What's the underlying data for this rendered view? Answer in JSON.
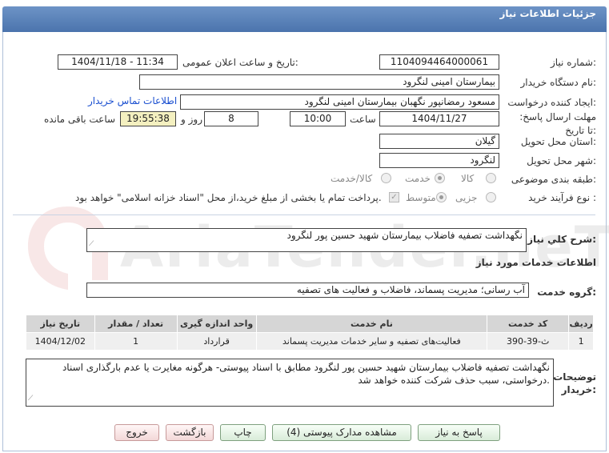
{
  "title": "جزئیات اطلاعات نیاز",
  "labels": {
    "need_number": "شماره نیاز:",
    "announce_datetime": "تاریخ و ساعت اعلان عمومی:",
    "buyer_org": "نام دستگاه خریدار:",
    "requester": "ایجاد کننده درخواست:",
    "deadline": "مهلت ارسال پاسخ: تا تاریخ:",
    "time": "ساعت",
    "day_and": "روز و",
    "remaining": "ساعت باقی مانده",
    "province": "استان محل تحویل:",
    "city": "شهر محل تحویل:",
    "category": "طبقه بندی موضوعی:",
    "purchase_type": "نوع فرآیند خرید :",
    "general_desc": "شرح کلي نياز:",
    "services_info": "اطلاعات خدمات مورد نیاز",
    "service_group": "گروه خدمت:",
    "buyer_notes": "توضیحات خریدار:"
  },
  "values": {
    "need_number": "1104094464000061",
    "announce_datetime": "1404/11/18 - 11:34",
    "buyer_org": "بیمارستان امینی لنگرود",
    "requester": "مسعود رمضانپور نگهبان بیمارستان امینی لنگرود",
    "contact_link": "اطلاعات تماس خریدار",
    "deadline_date": "1404/11/27",
    "deadline_time": "10:00",
    "days": "8",
    "remaining_time": "19:55:38",
    "province": "گیلان",
    "city": "لنگرود",
    "general_desc": "نگهداشت تصفیه فاضلاب بیمارستان شهید حسین پور لنگرود",
    "service_group": "آب رسانی؛ مدیریت پسماند، فاضلاب و فعالیت های تصفیه",
    "buyer_notes": "نگهداشت تصفیه فاضلاب بیمارستان شهید حسین پور لنگرود مطابق با اسناد پیوستی- هرگونه مغایرت یا عدم بارگذاری اسناد درخواستی، سبب حذف شرکت کننده خواهد شد."
  },
  "category_options": [
    "کالا",
    "خدمت",
    "کالا/خدمت"
  ],
  "category_selected": "خدمت",
  "purchase_options": [
    "جزیی",
    "متوسط"
  ],
  "purchase_selected": "متوسط",
  "payment_note": "پرداخت تمام یا بخشی از مبلغ خرید،از محل \"اسناد خزانه اسلامی\" خواهد بود.",
  "table": {
    "headers": [
      "ردیف",
      "کد خدمت",
      "نام خدمت",
      "واحد اندازه گیری",
      "تعداد / مقدار",
      "تاریخ نیاز"
    ],
    "rows": [
      [
        "1",
        "ث-39-390",
        "فعالیت‌های تصفیه و سایر خدمات مدیریت پسماند",
        "قرارداد",
        "1",
        "1404/12/02"
      ]
    ]
  },
  "buttons": {
    "reply": "پاسخ به نیاز",
    "view_docs": "مشاهده مدارک پیوستی (4)",
    "print": "چاپ",
    "back": "بازگشت",
    "exit": "خروج"
  },
  "watermark": "AriaTender.neT"
}
